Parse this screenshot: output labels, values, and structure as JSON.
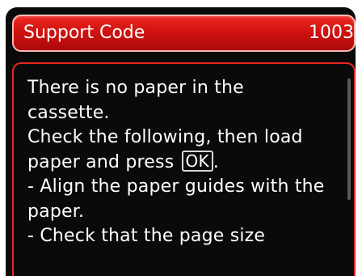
{
  "title_bar": {
    "label": "Support Code",
    "code": "1003"
  },
  "message": {
    "line1": "There is no paper in the",
    "line2": "cassette.",
    "line3": "Check the following, then load",
    "line4_before": "paper and press ",
    "ok_key": "OK",
    "line4_after": ".",
    "line5": "- Align the paper guides with the",
    "line6": "paper.",
    "line7": "- Check that the page size"
  },
  "colors": {
    "title_bar": "#d1130f",
    "border": "#e8281f",
    "background": "#0a0a0a",
    "text": "#ffffff"
  }
}
